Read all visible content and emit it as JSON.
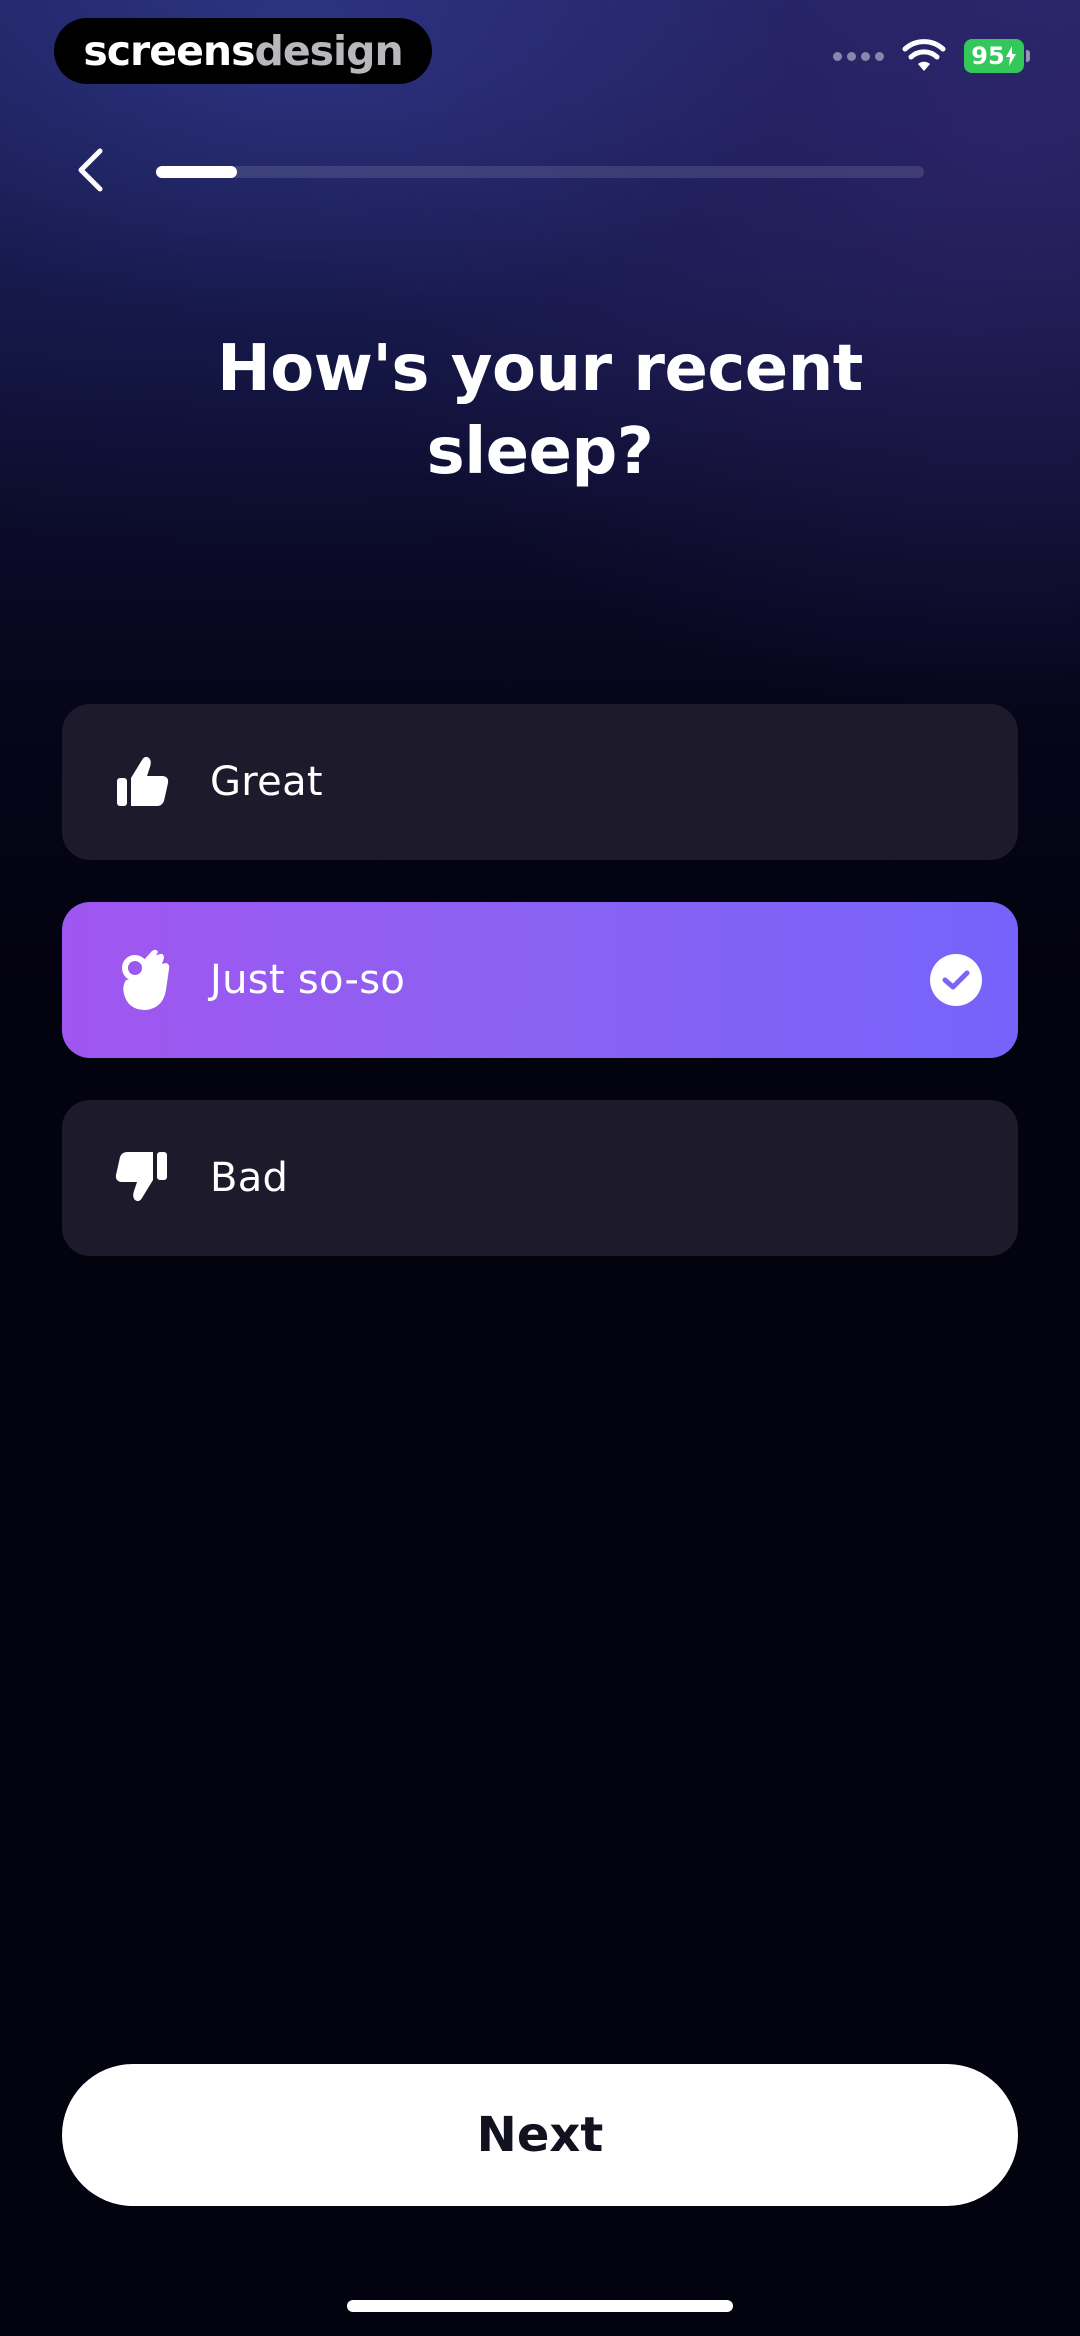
{
  "status_bar": {
    "brand_part1": "screens",
    "brand_part2": "design",
    "battery_level": "95",
    "battery_color": "#34c759",
    "wifi_icon": "wifi-icon"
  },
  "nav": {
    "back_icon": "chevron-left-icon",
    "progress_fraction": 0.105
  },
  "question": {
    "title": "How's your recent sleep?"
  },
  "options": [
    {
      "label": "Great",
      "icon": "thumbs-up-icon",
      "selected": false
    },
    {
      "label": "Just so-so",
      "icon": "ok-hand-icon",
      "selected": true
    },
    {
      "label": "Bad",
      "icon": "thumbs-down-icon",
      "selected": false
    }
  ],
  "selected_check_icon": "checkmark-circle-icon",
  "colors": {
    "option_bg": "#1c1a2b",
    "selected_gradient_start": "#a056f0",
    "selected_gradient_end": "#7663fb",
    "background": "#03020f"
  },
  "footer": {
    "next_label": "Next"
  }
}
